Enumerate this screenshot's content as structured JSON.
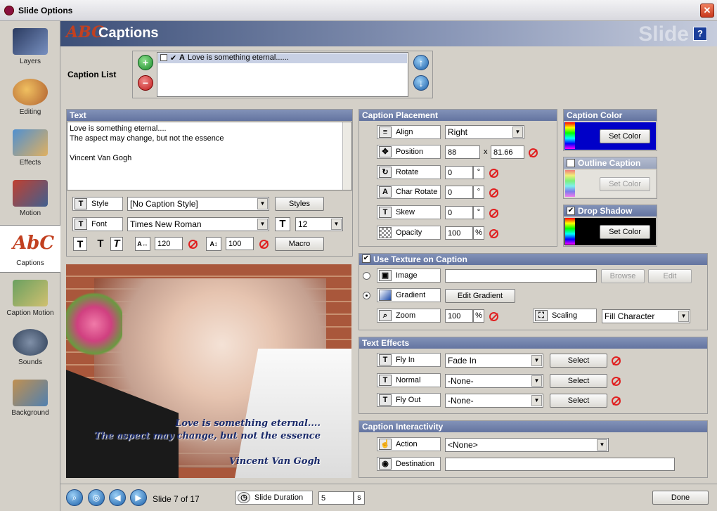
{
  "window": {
    "title": "Slide Options",
    "close": "✕"
  },
  "header": {
    "title": "Captions",
    "watermark": "Slide",
    "help": "?",
    "logo": "ABC"
  },
  "sidebar": {
    "items": [
      {
        "label": "Layers",
        "icon": "layers-icon"
      },
      {
        "label": "Editing",
        "icon": "editing-icon"
      },
      {
        "label": "Effects",
        "icon": "effects-icon"
      },
      {
        "label": "Motion",
        "icon": "motion-icon"
      },
      {
        "label": "Captions",
        "icon": "captions-icon"
      },
      {
        "label": "Caption Motion",
        "icon": "caption-motion-icon"
      },
      {
        "label": "Sounds",
        "icon": "sounds-icon"
      },
      {
        "label": "Background",
        "icon": "background-icon"
      }
    ]
  },
  "caption_list": {
    "label": "Caption List",
    "items": [
      {
        "text": "Love is something eternal......"
      }
    ]
  },
  "text_panel": {
    "title": "Text",
    "content": "Love is something eternal....\nThe aspect may change, but not the essence\n\nVincent Van Gogh",
    "style_label": "Style",
    "style_value": "[No Caption Style]",
    "styles_button": "Styles",
    "font_label": "Font",
    "font_value": "Times New Roman",
    "size_value": "12",
    "char_spacing": "120",
    "line_spacing": "100",
    "macro_button": "Macro"
  },
  "preview": {
    "lines": [
      "Love is something eternal....",
      "The aspect may change, but not the essence",
      "Vincent Van Gogh"
    ]
  },
  "placement": {
    "title": "Caption Placement",
    "align_label": "Align",
    "align_value": "Right",
    "position_label": "Position",
    "pos_x": "88",
    "pos_sep": "x",
    "pos_y": "81.66",
    "rotate_label": "Rotate",
    "rotate_value": "0",
    "char_rotate_label": "Char Rotate",
    "char_rotate_value": "0",
    "skew_label": "Skew",
    "skew_value": "0",
    "opacity_label": "Opacity",
    "opacity_value": "100",
    "deg": "°",
    "pct": "%"
  },
  "caption_color": {
    "title": "Caption Color",
    "button": "Set Color",
    "color": "#0000c8"
  },
  "outline": {
    "title": "Outline Caption",
    "button": "Set Color"
  },
  "shadow": {
    "title": "Drop Shadow",
    "button": "Set Color",
    "color": "#000000"
  },
  "texture": {
    "title": "Use Texture on Caption",
    "image_label": "Image",
    "browse": "Browse",
    "edit": "Edit",
    "gradient_label": "Gradient",
    "edit_gradient": "Edit Gradient",
    "zoom_label": "Zoom",
    "zoom_value": "100",
    "pct": "%",
    "scaling_label": "Scaling",
    "scaling_value": "Fill Character"
  },
  "effects": {
    "title": "Text Effects",
    "rows": [
      {
        "label": "Fly In",
        "value": "Fade In",
        "button": "Select",
        "icon": "fly-in-icon"
      },
      {
        "label": "Normal",
        "value": "-None-",
        "button": "Select",
        "icon": "normal-icon"
      },
      {
        "label": "Fly Out",
        "value": "-None-",
        "button": "Select",
        "icon": "fly-out-icon"
      }
    ]
  },
  "interactivity": {
    "title": "Caption Interactivity",
    "action_label": "Action",
    "action_value": "<None>",
    "destination_label": "Destination"
  },
  "status": {
    "slide": "Slide 7 of 17",
    "duration_label": "Slide Duration",
    "duration_value": "5",
    "unit": "s",
    "done": "Done"
  }
}
